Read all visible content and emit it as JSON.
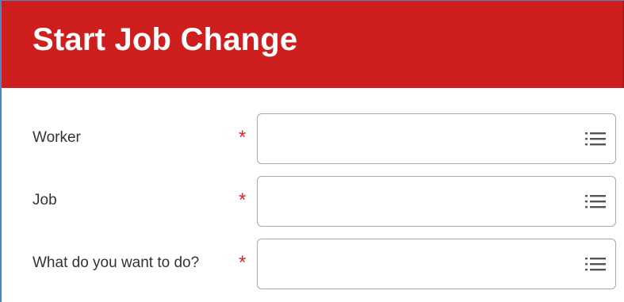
{
  "header": {
    "title": "Start Job Change",
    "background_color": "#cf1e1e"
  },
  "form": {
    "required_marker": "*",
    "required_color": "#e0262b",
    "fields": [
      {
        "label": "Worker",
        "value": "",
        "icon": "list-icon"
      },
      {
        "label": "Job",
        "value": "",
        "icon": "list-icon"
      },
      {
        "label": "What do you want to do?",
        "value": "",
        "icon": "list-icon"
      }
    ]
  }
}
